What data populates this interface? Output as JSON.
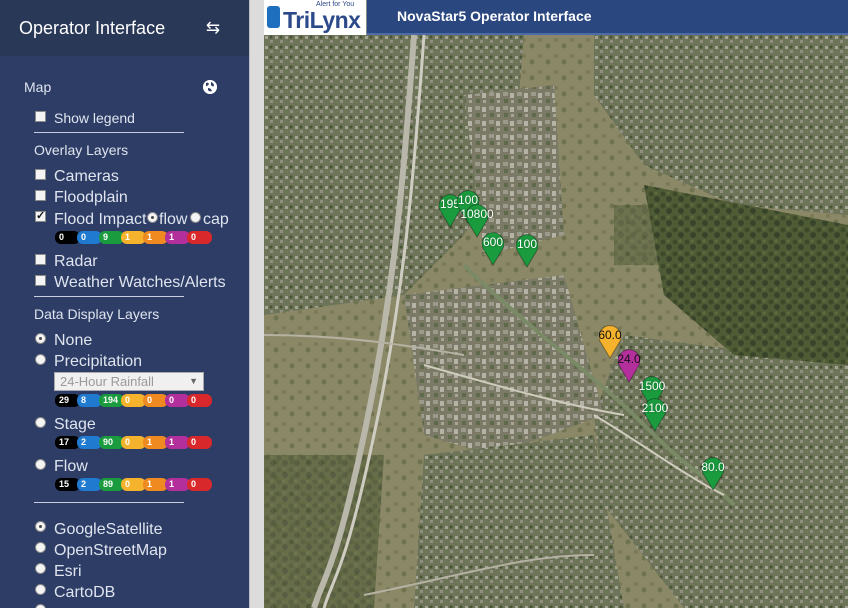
{
  "sidebar": {
    "title": "Operator Interface",
    "map_label": "Map",
    "show_legend": "Show legend",
    "overlay_header": "Overlay Layers",
    "overlays": {
      "cameras": "Cameras",
      "floodplain": "Floodplain",
      "flood_impact": "Flood Impact",
      "flow_option": "flow",
      "cap_option": "cap",
      "radar": "Radar",
      "weather": "Weather Watches/Alerts"
    },
    "flood_badges": [
      "0",
      "0",
      "9",
      "1",
      "1",
      "1",
      "0"
    ],
    "data_header": "Data Display Layers",
    "data_layers": {
      "none": "None",
      "precipitation": "Precipitation",
      "precip_select": "24-Hour Rainfall",
      "stage": "Stage",
      "flow": "Flow"
    },
    "precip_badges": [
      "29",
      "8",
      "194",
      "0",
      "0",
      "0",
      "0"
    ],
    "stage_badges": [
      "17",
      "2",
      "90",
      "0",
      "1",
      "1",
      "0"
    ],
    "flow_badges": [
      "15",
      "2",
      "89",
      "0",
      "1",
      "1",
      "0"
    ],
    "basemaps": {
      "google": "GoogleSatellite",
      "osm": "OpenStreetMap",
      "esri": "Esri",
      "carto": "CartoDB"
    }
  },
  "topbar": {
    "logo_text": "TriLynx",
    "logo_tagline": "Alert for You",
    "title": "NovaStar5 Operator Interface"
  },
  "colors": {
    "sidebar_bg": "#2d3d66",
    "topbar_bg": "#2b4780",
    "green": "#1a9b3e",
    "yellow": "#f4b22d",
    "purple": "#b32f9c"
  },
  "map_markers": [
    {
      "label": "195",
      "color": "green"
    },
    {
      "label": "100",
      "color": "green"
    },
    {
      "label": "10800",
      "color": "green"
    },
    {
      "label": "600",
      "color": "green"
    },
    {
      "label": "100",
      "color": "green"
    },
    {
      "label": "60.0",
      "color": "yellow"
    },
    {
      "label": "24.0",
      "color": "purple"
    },
    {
      "label": "1500",
      "color": "green"
    },
    {
      "label": "2100",
      "color": "green"
    },
    {
      "label": "80.0",
      "color": "green"
    }
  ]
}
